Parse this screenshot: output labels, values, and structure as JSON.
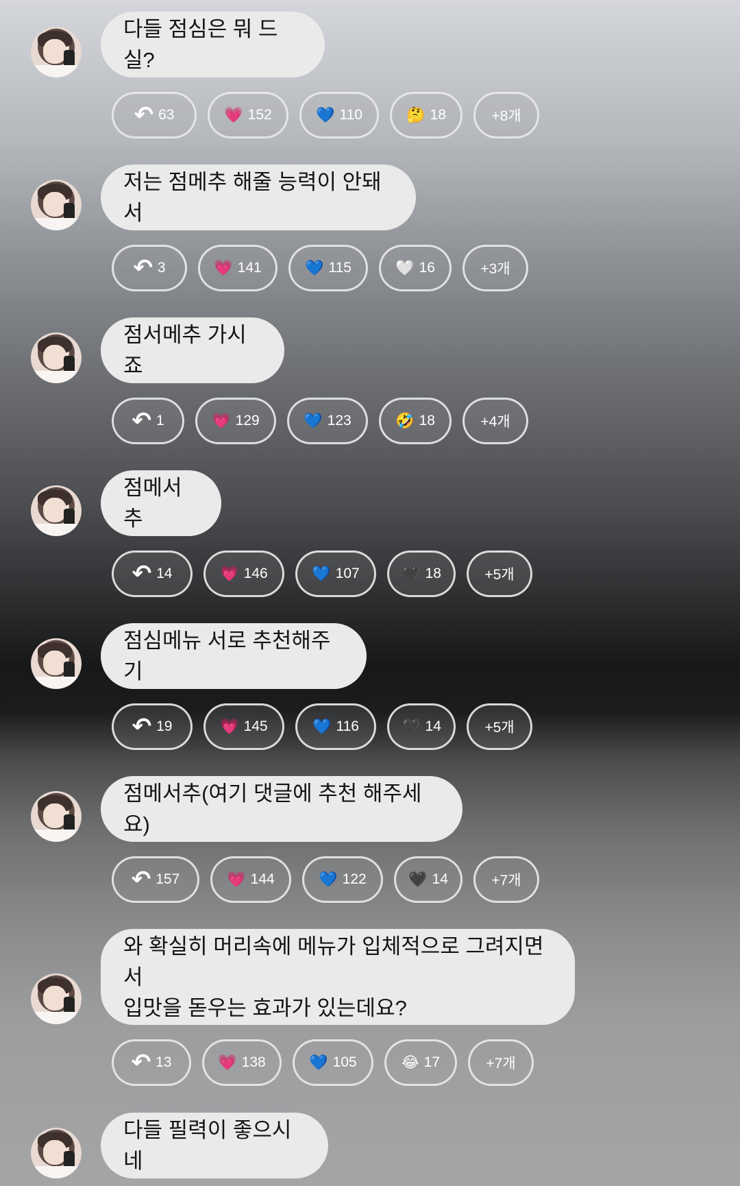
{
  "messages": [
    {
      "text": "다들 점심은 뭐 드실?",
      "reactions": [
        {
          "icon": "reply-icon",
          "glyph": "↶",
          "count": "63"
        },
        {
          "icon": "pink-heart-icon",
          "glyph": "💗",
          "count": "152"
        },
        {
          "icon": "blue-heart-icon",
          "glyph": "💙",
          "count": "110"
        },
        {
          "icon": "thinking-face-icon",
          "glyph": "🤔",
          "count": "18"
        },
        {
          "icon": "more",
          "glyph": "",
          "count": "+8개"
        }
      ]
    },
    {
      "text": "저는 점메추 해줄 능력이 안돼서",
      "reactions": [
        {
          "icon": "reply-icon",
          "glyph": "↶",
          "count": "3"
        },
        {
          "icon": "pink-heart-icon",
          "glyph": "💗",
          "count": "141"
        },
        {
          "icon": "blue-heart-icon",
          "glyph": "💙",
          "count": "115"
        },
        {
          "icon": "white-heart-icon",
          "glyph": "🤍",
          "count": "16"
        },
        {
          "icon": "more",
          "glyph": "",
          "count": "+3개"
        }
      ]
    },
    {
      "text": "점서메추 가시죠",
      "reactions": [
        {
          "icon": "reply-icon",
          "glyph": "↶",
          "count": "1"
        },
        {
          "icon": "pink-heart-icon",
          "glyph": "💗",
          "count": "129"
        },
        {
          "icon": "blue-heart-icon",
          "glyph": "💙",
          "count": "123"
        },
        {
          "icon": "rofl-face-icon",
          "glyph": "🤣",
          "count": "18"
        },
        {
          "icon": "more",
          "glyph": "",
          "count": "+4개"
        }
      ]
    },
    {
      "text": "점메서추",
      "reactions": [
        {
          "icon": "reply-icon",
          "glyph": "↶",
          "count": "14"
        },
        {
          "icon": "pink-heart-icon",
          "glyph": "💗",
          "count": "146"
        },
        {
          "icon": "blue-heart-icon",
          "glyph": "💙",
          "count": "107"
        },
        {
          "icon": "black-heart-icon",
          "glyph": "🖤",
          "count": "18"
        },
        {
          "icon": "more",
          "glyph": "",
          "count": "+5개"
        }
      ]
    },
    {
      "text": "점심메뉴 서로 추천해주기",
      "reactions": [
        {
          "icon": "reply-icon",
          "glyph": "↶",
          "count": "19"
        },
        {
          "icon": "pink-heart-icon",
          "glyph": "💗",
          "count": "145"
        },
        {
          "icon": "blue-heart-icon",
          "glyph": "💙",
          "count": "116"
        },
        {
          "icon": "black-heart-icon",
          "glyph": "🖤",
          "count": "14"
        },
        {
          "icon": "more",
          "glyph": "",
          "count": "+5개"
        }
      ]
    },
    {
      "text": "점메서추(여기 댓글에 추천 해주세요)",
      "reactions": [
        {
          "icon": "reply-icon",
          "glyph": "↶",
          "count": "157"
        },
        {
          "icon": "pink-heart-icon",
          "glyph": "💗",
          "count": "144"
        },
        {
          "icon": "blue-heart-icon",
          "glyph": "💙",
          "count": "122"
        },
        {
          "icon": "black-heart-icon",
          "glyph": "🖤",
          "count": "14"
        },
        {
          "icon": "more",
          "glyph": "",
          "count": "+7개"
        }
      ]
    },
    {
      "text": "와 확실히 머리속에 메뉴가 입체적으로 그려지면서\n입맛을 돋우는 효과가 있는데요?",
      "reactions": [
        {
          "icon": "reply-icon",
          "glyph": "↶",
          "count": "13"
        },
        {
          "icon": "pink-heart-icon",
          "glyph": "💗",
          "count": "138"
        },
        {
          "icon": "blue-heart-icon",
          "glyph": "💙",
          "count": "105"
        },
        {
          "icon": "joy-face-icon",
          "glyph": "😂",
          "count": "17"
        },
        {
          "icon": "more",
          "glyph": "",
          "count": "+7개"
        }
      ]
    },
    {
      "text": "다들 필력이 좋으시네",
      "reactions": []
    }
  ]
}
